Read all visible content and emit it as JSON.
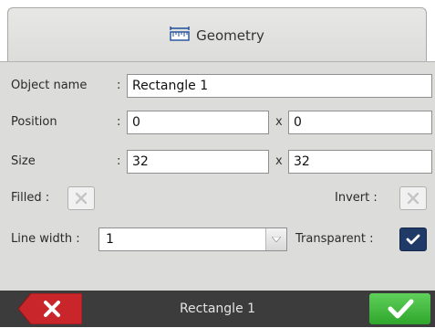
{
  "tab": {
    "title": "Geometry",
    "icon": "ruler-icon"
  },
  "form": {
    "object_name": {
      "label": "Object name",
      "colon": ":",
      "value": "Rectangle 1"
    },
    "position": {
      "label": "Position",
      "colon": ":",
      "x": "0",
      "sep": "x",
      "y": "0"
    },
    "size": {
      "label": "Size",
      "colon": ":",
      "w": "32",
      "sep": "x",
      "h": "32"
    },
    "filled": {
      "label": "Filled :",
      "checked": false
    },
    "invert": {
      "label": "Invert :",
      "checked": false
    },
    "line_width": {
      "label": "Line width :",
      "value": "1"
    },
    "transparent": {
      "label": "Transparent :",
      "checked": true
    }
  },
  "bottom_bar": {
    "status": "Rectangle 1",
    "cancel_icon": "close-icon",
    "ok_icon": "check-icon"
  },
  "colors": {
    "cancel": "#c8262b",
    "ok": "#3db83a",
    "checked": "#1f3a66",
    "panel": "#dcdcda",
    "bar": "#3c3c3c"
  }
}
